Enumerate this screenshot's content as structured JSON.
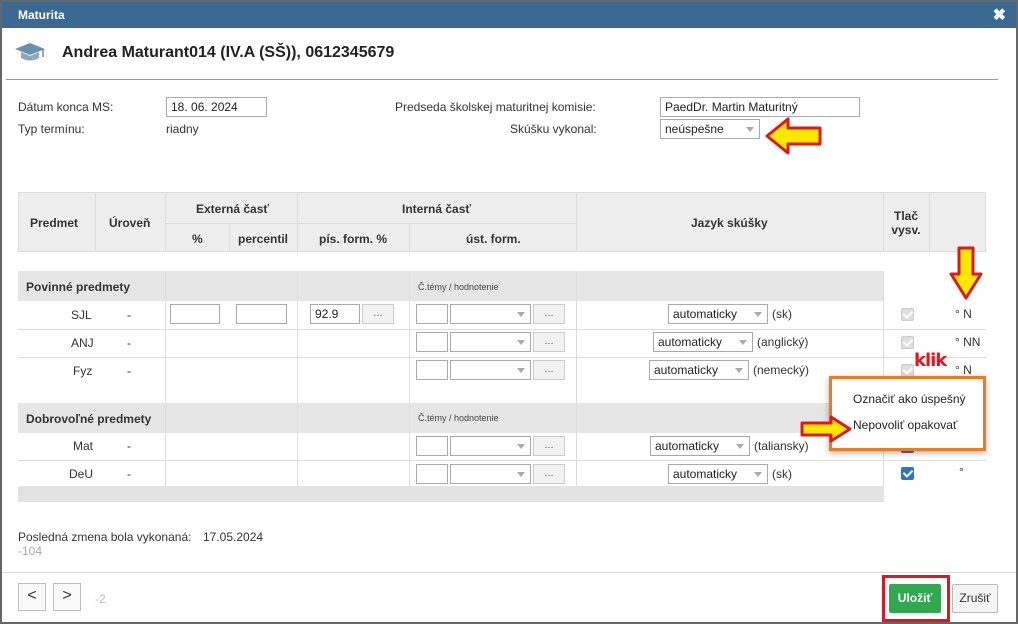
{
  "window": {
    "title": "Maturita",
    "close_glyph": "✖"
  },
  "header": {
    "title": "Andrea Maturant014 (IV.A (SŠ)), 0612345679",
    "icon": "graduation-cap-icon"
  },
  "form": {
    "date_label": "Dátum konca MS:",
    "date_value": "18. 06. 2024",
    "term_label": "Typ termínu:",
    "term_value": "riadny",
    "chair_label": "Predseda školskej maturitnej komisie:",
    "chair_value": "PaedDr. Martin Maturitný",
    "exam_label": "Skúšku vykonal:",
    "exam_value": "neúspešne"
  },
  "table": {
    "headers": {
      "subject": "Predmet",
      "level": "Úroveň",
      "external": "Externá časť",
      "internal": "Interná časť",
      "language": "Jazyk skúšky",
      "print": "Tlač vysv.",
      "percent": "%",
      "percentile": "percentil",
      "written": "pís. form. %",
      "oral": "úst. form."
    },
    "sections": [
      {
        "title": "Povinné predmety",
        "sub": "Č.témy / hodnotenie"
      },
      {
        "title": "Dobrovoľné predmety",
        "sub": "Č.témy / hodnotenie"
      }
    ],
    "rows": [
      {
        "subject": "SJL",
        "level": "-",
        "written": "92.9",
        "dots": "...",
        "lang": "automaticky",
        "lang_suffix": "(sk)",
        "flag": "° N"
      },
      {
        "subject": "ANJ",
        "level": "-",
        "dots": "...",
        "lang": "automaticky",
        "lang_suffix": "(anglický)",
        "flag": "° NN"
      },
      {
        "subject": "Fyz",
        "level": "-",
        "dots": "...",
        "lang": "automaticky",
        "lang_suffix": "(nemecký)",
        "flag": "° N"
      },
      {
        "subject": "Mat",
        "level": "-",
        "dots": "...",
        "lang": "automaticky",
        "lang_suffix": "(taliansky)",
        "flag": ""
      },
      {
        "subject": "DeU",
        "level": "-",
        "dots": "...",
        "lang": "automaticky",
        "lang_suffix": "(sk)",
        "flag": "°"
      }
    ]
  },
  "annotation": {
    "klik": "klik"
  },
  "context_menu": {
    "items": [
      "Označiť ako úspešný",
      "Nepovoliť opakovať"
    ]
  },
  "footer": {
    "last_change_label": "Posledná zmena bola vykonaná:",
    "last_change_value": "17.05.2024",
    "code": "-104",
    "prev": "<",
    "next": ">",
    "counter": "-2",
    "save": "Uložiť",
    "cancel": "Zrušiť"
  },
  "colors": {
    "titlebar": "#3a6a92",
    "save": "#2fa84f",
    "highlight": "#e2161f",
    "arrow_fill": "#ffe800",
    "popup_border": "#f07b1f"
  }
}
